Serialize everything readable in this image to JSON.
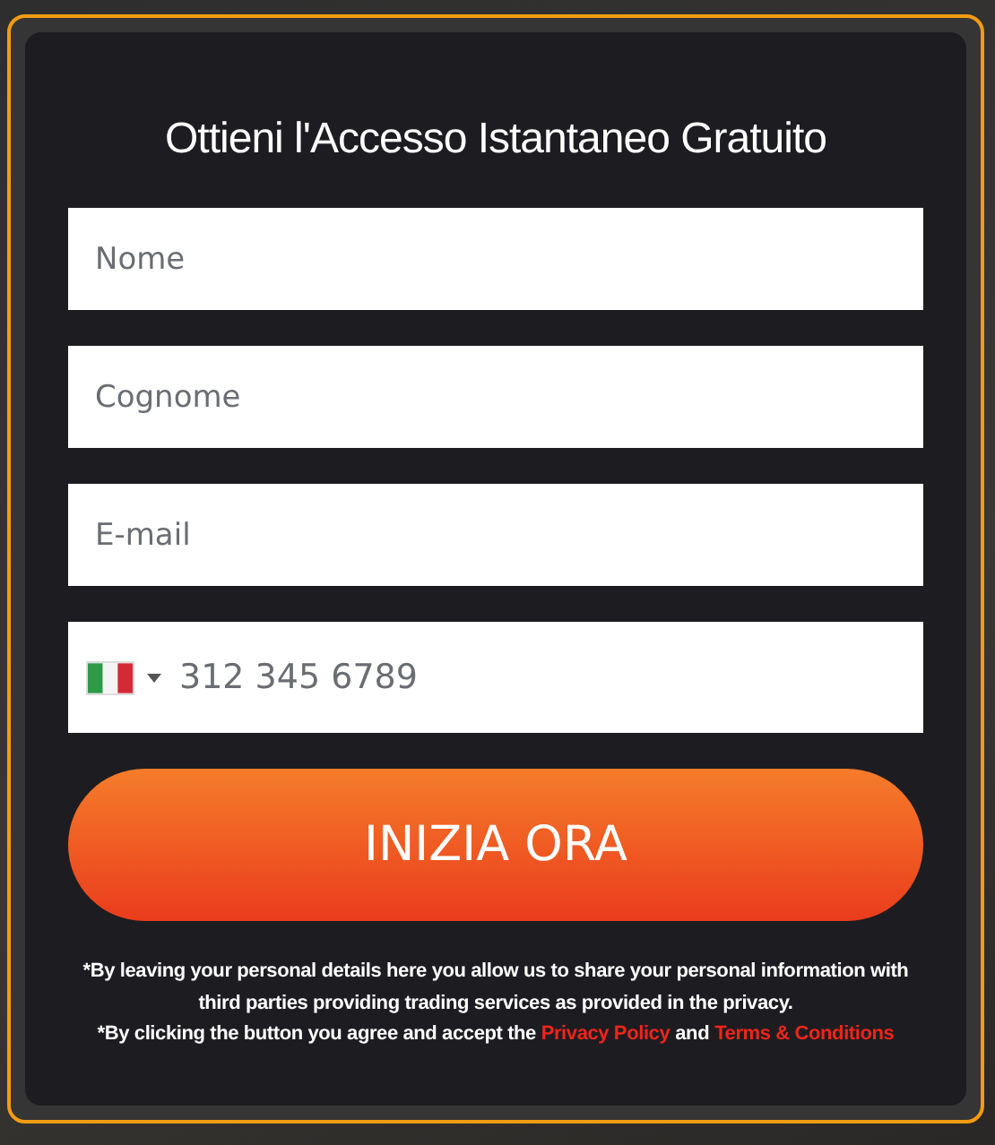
{
  "form": {
    "title": "Ottieni l'Accesso Istantaneo Gratuito",
    "fields": [
      {
        "kind": "text",
        "placeholder": "Nome"
      },
      {
        "kind": "text",
        "placeholder": "Cognome"
      },
      {
        "kind": "text",
        "placeholder": "E-mail"
      },
      {
        "kind": "phone",
        "placeholder": "312 345 6789"
      }
    ],
    "submit": "INIZIA ORA",
    "disclaimer": "*By leaving your personal details here you allow us to share your personal information with third parties providing trading services as provided in the privacy.",
    "consent": {
      "prefix": "*By clicking the button you agree and accept the",
      "links": [
        "Privacy Policy",
        "Terms & Conditions"
      ],
      "joiner": "and"
    }
  }
}
